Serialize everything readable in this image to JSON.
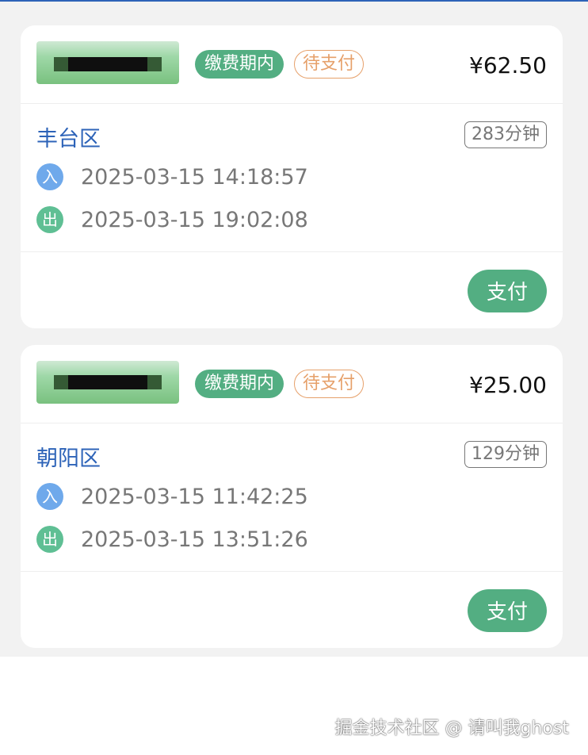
{
  "orders": [
    {
      "status_badge": "缴费期内",
      "payment_badge": "待支付",
      "price": "¥62.50",
      "region": "丰台区",
      "duration": "283分钟",
      "entry_icon": "入",
      "entry_time": "2025-03-15 14:18:57",
      "exit_icon": "出",
      "exit_time": "2025-03-15 19:02:08",
      "pay_label": "支付"
    },
    {
      "status_badge": "缴费期内",
      "payment_badge": "待支付",
      "price": "¥25.00",
      "region": "朝阳区",
      "duration": "129分钟",
      "entry_icon": "入",
      "entry_time": "2025-03-15 11:42:25",
      "exit_icon": "出",
      "exit_time": "2025-03-15 13:51:26",
      "pay_label": "支付"
    }
  ],
  "watermark": "掘金技术社区 @ 请叫我ghost",
  "colors": {
    "accent_green": "#53ae82",
    "pending_orange": "#e6a06a",
    "region_blue": "#2d63b8",
    "entry_blue": "#6fa9eb",
    "exit_green": "#5fbf94"
  }
}
